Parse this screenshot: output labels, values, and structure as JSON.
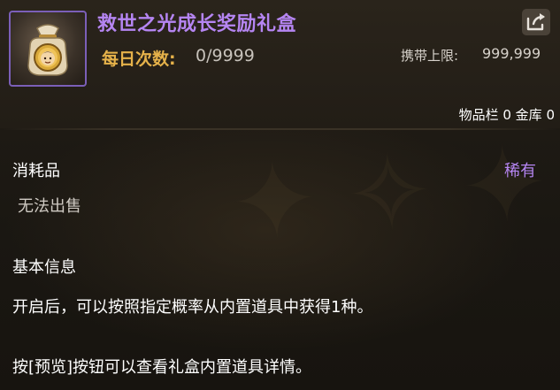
{
  "item": {
    "title": "救世之光成长奖励礼盒",
    "icon": "gift-bag-icon",
    "title_color": "#b585f2"
  },
  "daily": {
    "label": "每日次数:",
    "value": "0/9999"
  },
  "carry": {
    "label": "携带上限:",
    "value": "999,999"
  },
  "storage": {
    "text": "物品栏 0 金库 0"
  },
  "share": {
    "icon": "share-icon"
  },
  "details": {
    "category": "消耗品",
    "rarity": "稀有",
    "sale_note": "无法出售"
  },
  "info": {
    "section_title": "基本信息",
    "line1": "开启后，可以按照指定概率从内置道具中获得1种。",
    "line2": "按[预览]按钮可以查看礼盒内置道具详情。"
  },
  "colors": {
    "rare_purple": "#b585f2",
    "gold": "#e6b24a",
    "frame_purple": "#7b5fb8"
  }
}
